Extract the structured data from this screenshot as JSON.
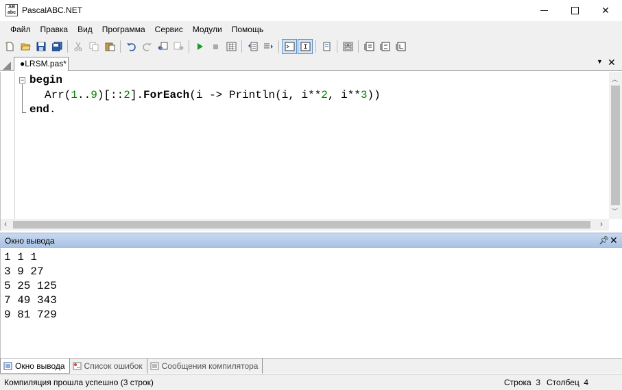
{
  "window": {
    "title": "PascalABC.NET",
    "icon": "pascalabc-app-icon"
  },
  "menu": [
    "Файл",
    "Правка",
    "Вид",
    "Программа",
    "Сервис",
    "Модули",
    "Помощь"
  ],
  "toolbar": {
    "buttons": [
      "new-file",
      "open",
      "save",
      "save-all",
      "cut",
      "copy",
      "paste",
      "undo",
      "redo",
      "navigate-back",
      "navigate-forward",
      "run",
      "stop",
      "compile",
      "comment",
      "uncomment",
      "output-window",
      "text-mode",
      "debug",
      "form-designer",
      "step-into",
      "step-over",
      "step-out"
    ]
  },
  "tab": {
    "label": "●LRSM.pas*"
  },
  "editor": {
    "lines": {
      "l1_kw": "begin",
      "l2_a": "Arr(",
      "l2_n1": "1",
      "l2_b": "..",
      "l2_n2": "9",
      "l2_c": ")[::",
      "l2_n3": "2",
      "l2_d": "].",
      "l2_kw": "ForEach",
      "l2_e": "(i -> Println(i, i**",
      "l2_n4": "2",
      "l2_f": ", i**",
      "l2_n5": "3",
      "l2_g": "))",
      "l3_kw": "end",
      "l3_dot": "."
    }
  },
  "output": {
    "title": "Окно вывода",
    "lines": [
      "1 1 1",
      "3 9 27",
      "5 25 125",
      "7 49 343",
      "9 81 729"
    ]
  },
  "bottom_tabs": [
    "Окно вывода",
    "Список ошибок",
    "Сообщения компилятора"
  ],
  "status": {
    "message": "Компиляция прошла успешно (3 строк)",
    "row": "Строка  3",
    "col": "Столбец  4"
  },
  "colors": {
    "number": "#008000",
    "panel_header": "#b8cfea",
    "toolbar_active": "#d4e4f7"
  }
}
